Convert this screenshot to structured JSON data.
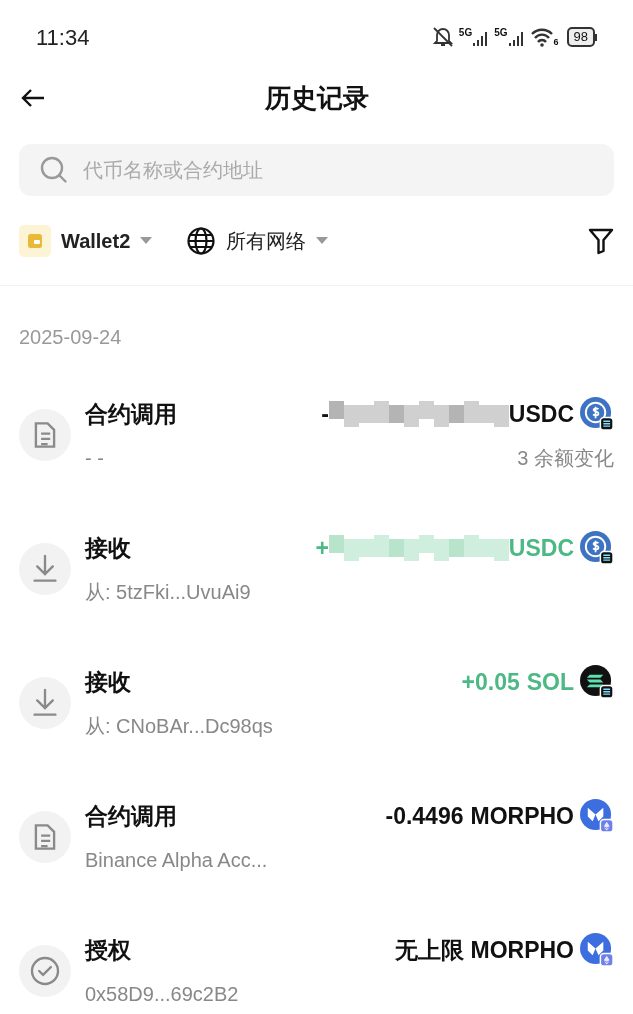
{
  "status_bar": {
    "time": "11:34",
    "networks": [
      "5G",
      "5G"
    ],
    "wifi_label": "6",
    "battery": "98"
  },
  "header": {
    "title": "历史记录"
  },
  "search": {
    "placeholder": "代币名称或合约地址"
  },
  "filters": {
    "wallet": "Wallet2",
    "network": "所有网络"
  },
  "date": "2025-09-24",
  "transactions": [
    {
      "kind": "contract",
      "title": "合约调用",
      "subtitle": "- -",
      "amount": "-",
      "redacted": true,
      "token": "USDC",
      "color": "#111111",
      "token_logo": {
        "kind": "usdc",
        "badge": {
          "kind": "solana"
        }
      },
      "note": "3 余额变化"
    },
    {
      "kind": "receive",
      "title": "接收",
      "subtitle": "从: 5tzFki...UvuAi9",
      "amount": "+",
      "redacted": true,
      "token": "USDC",
      "color": "#4cb884",
      "token_logo": {
        "kind": "usdc",
        "badge": {
          "kind": "solana"
        }
      }
    },
    {
      "kind": "receive",
      "title": "接收",
      "subtitle": "从: CNoBAr...Dc98qs",
      "amount": "+0.05",
      "redacted": false,
      "token": "SOL",
      "color": "#4cb884",
      "token_logo": {
        "kind": "sol",
        "badge": {
          "kind": "solana"
        }
      }
    },
    {
      "kind": "contract",
      "title": "合约调用",
      "subtitle": "Binance Alpha Acc...",
      "amount": "-0.4496",
      "redacted": false,
      "token": "MORPHO",
      "color": "#111111",
      "token_logo": {
        "kind": "morpho",
        "badge": {
          "kind": "ethereum"
        }
      }
    },
    {
      "kind": "approve",
      "title": "授权",
      "subtitle": "0x58D9...69c2B2",
      "amount": "无上限",
      "redacted": false,
      "token": "MORPHO",
      "color": "#111111",
      "token_logo": {
        "kind": "morpho",
        "badge": {
          "kind": "ethereum"
        }
      }
    }
  ]
}
